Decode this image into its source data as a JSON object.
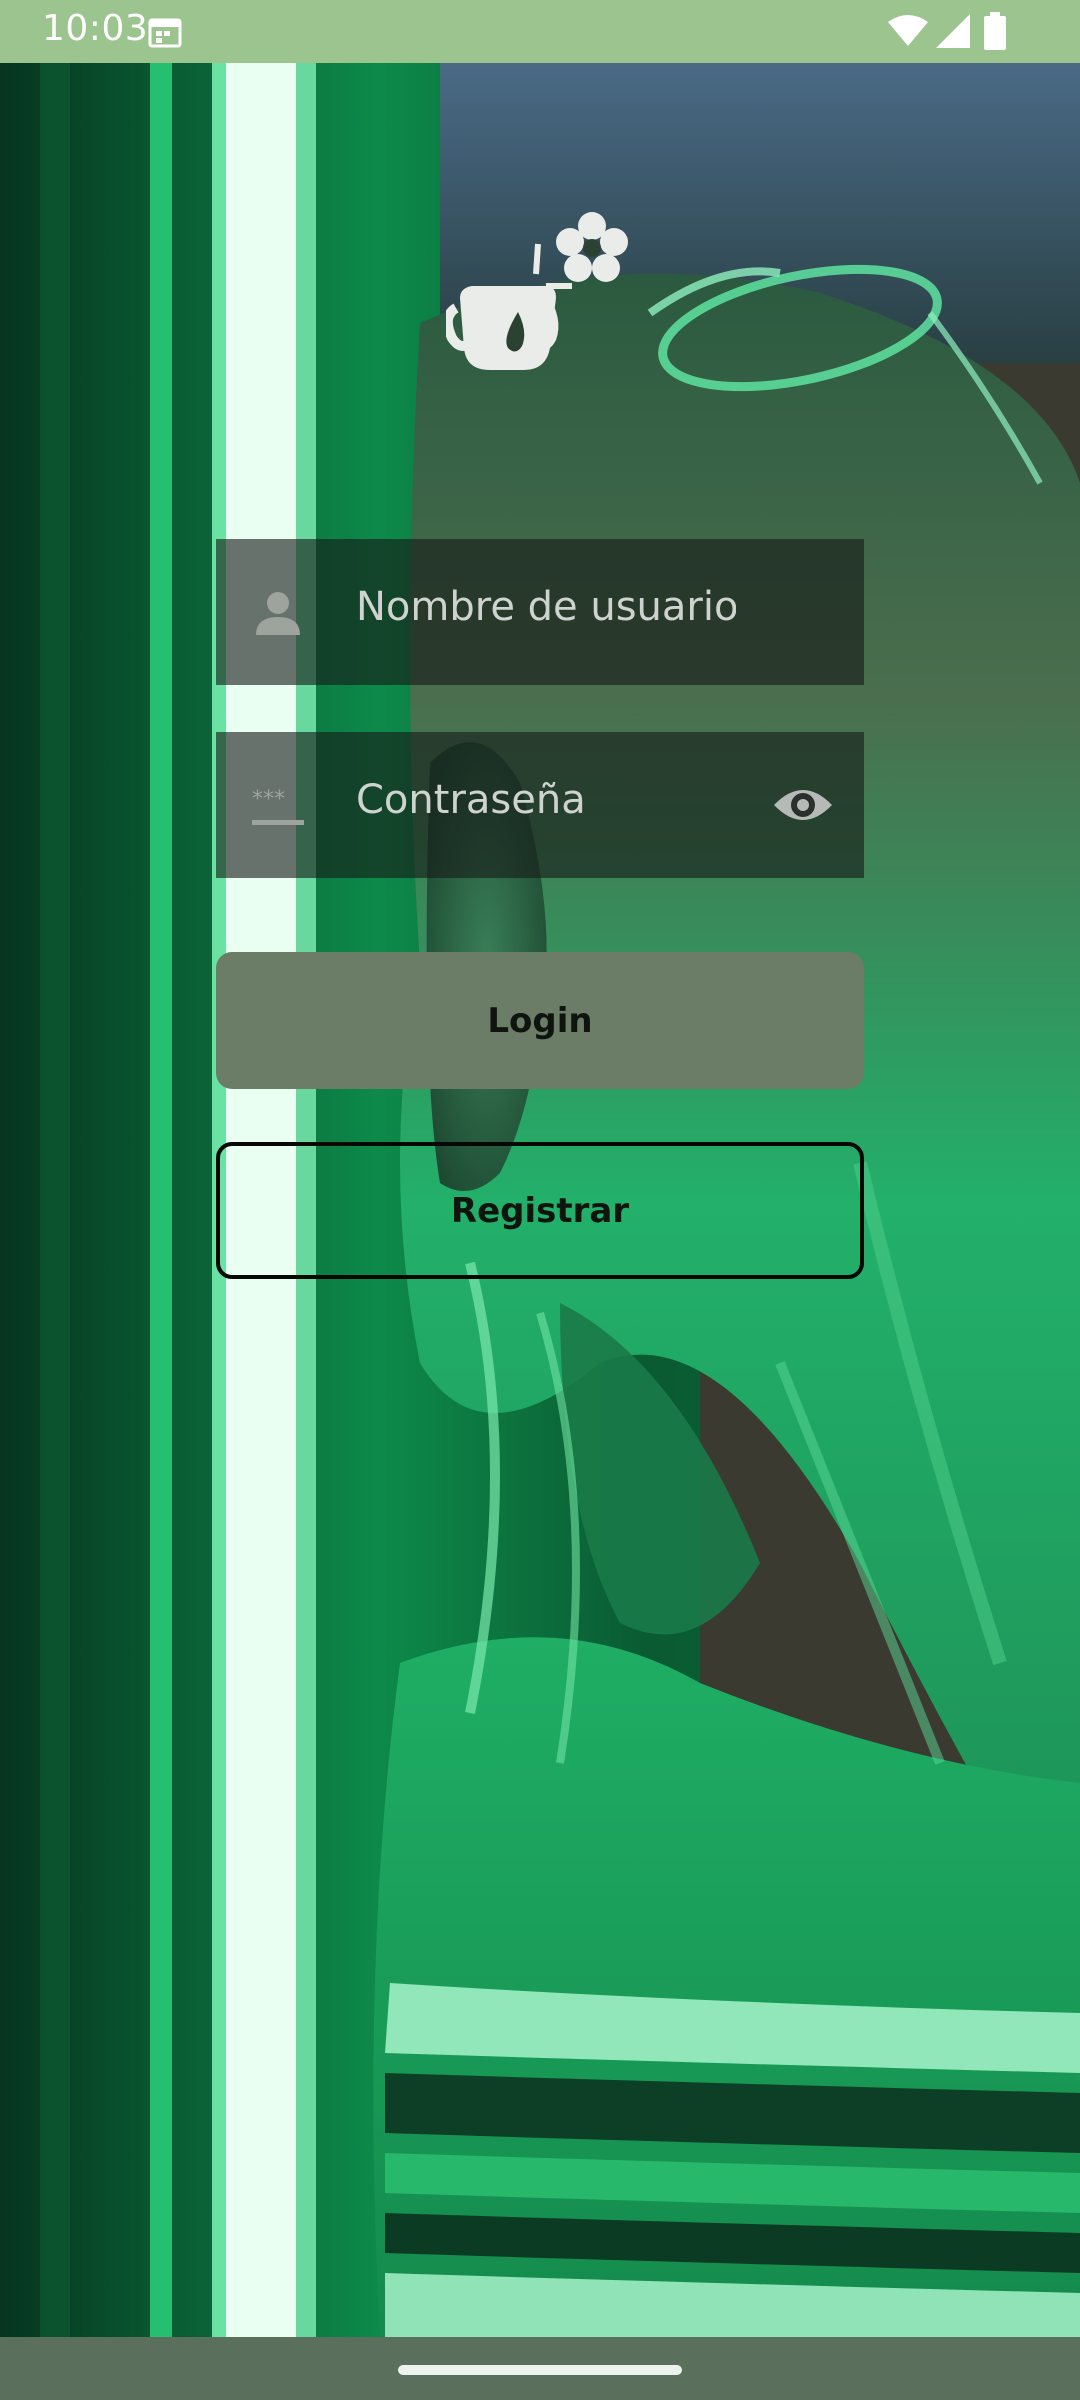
{
  "status_bar": {
    "time": "10:03",
    "icons": [
      "calendar-icon",
      "wifi-icon",
      "signal-icon",
      "battery-icon"
    ]
  },
  "app": {
    "logo_icon": "cafe-flower-logo-icon"
  },
  "form": {
    "username_placeholder": "Nombre de usuario",
    "password_placeholder": "Contraseña",
    "username_icon": "person-icon",
    "password_icon": "password-dots-icon",
    "visibility_icon": "eye-icon"
  },
  "buttons": {
    "login_label": "Login",
    "register_label": "Registrar"
  },
  "colors": {
    "status_bar": "#9bc48f",
    "login_button": "#6b7c67",
    "nav_bar": "#5b6f5d",
    "field_background": "rgba(22,28,24,0.62)"
  }
}
